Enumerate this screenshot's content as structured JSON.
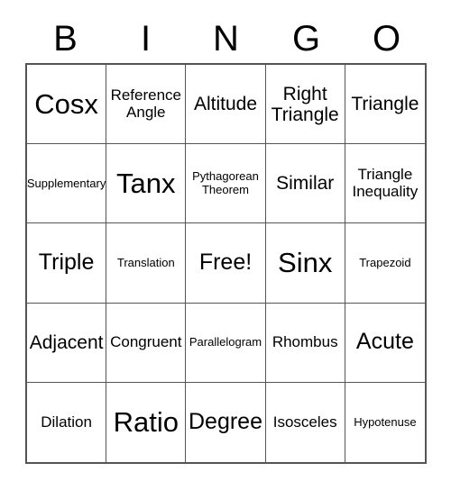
{
  "card": {
    "title": "BINGO",
    "header": {
      "letters": [
        "B",
        "I",
        "N",
        "G",
        "O"
      ]
    },
    "grid": {
      "columns": 5,
      "rows": 5,
      "free_space_label": "Free!",
      "free_space_index": 12,
      "border_color": "#555555",
      "background_color": "#ffffff",
      "text_color": "#000000",
      "cells": [
        {
          "label": "Cosx",
          "size": "fs-xl"
        },
        {
          "label": "Reference\nAngle",
          "size": "fs-sm"
        },
        {
          "label": "Altitude",
          "size": "fs-md"
        },
        {
          "label": "Right\nTriangle",
          "size": "fs-md"
        },
        {
          "label": "Triangle",
          "size": "fs-md"
        },
        {
          "label": "Supplementary",
          "size": "fs-xs"
        },
        {
          "label": "Tanx",
          "size": "fs-xl"
        },
        {
          "label": "Pythagorean\nTheorem",
          "size": "fs-xs"
        },
        {
          "label": "Similar",
          "size": "fs-md"
        },
        {
          "label": "Triangle\nInequality",
          "size": "fs-sm"
        },
        {
          "label": "Triple",
          "size": "fs-lg"
        },
        {
          "label": "Translation",
          "size": "fs-xs"
        },
        {
          "label": "Free!",
          "size": "fs-lg"
        },
        {
          "label": "Sinx",
          "size": "fs-xl"
        },
        {
          "label": "Trapezoid",
          "size": "fs-xs"
        },
        {
          "label": "Adjacent",
          "size": "fs-md"
        },
        {
          "label": "Congruent",
          "size": "fs-sm"
        },
        {
          "label": "Parallelogram",
          "size": "fs-xs"
        },
        {
          "label": "Rhombus",
          "size": "fs-sm"
        },
        {
          "label": "Acute",
          "size": "fs-lg"
        },
        {
          "label": "Dilation",
          "size": "fs-sm"
        },
        {
          "label": "Ratio",
          "size": "fs-xl"
        },
        {
          "label": "Degree",
          "size": "fs-lg"
        },
        {
          "label": "Isosceles",
          "size": "fs-sm"
        },
        {
          "label": "Hypotenuse",
          "size": "fs-xs"
        }
      ]
    }
  }
}
